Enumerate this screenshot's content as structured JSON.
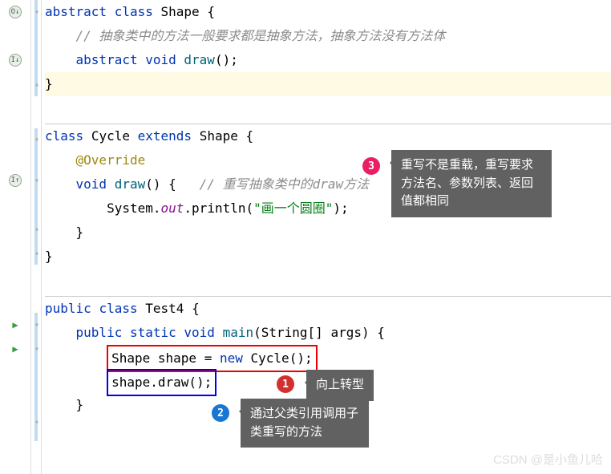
{
  "code": {
    "shape_decl": {
      "kw1": "abstract",
      "kw2": "class",
      "name": "Shape",
      "brace": "{"
    },
    "shape_comment": "// 抽象类中的方法一般要求都是抽象方法，抽象方法没有方法体",
    "shape_method": {
      "kw1": "abstract",
      "kw2": "void",
      "name": "draw",
      "parens": "();"
    },
    "close_brace": "}",
    "cycle_decl": {
      "kw1": "class",
      "name": "Cycle",
      "kw2": "extends",
      "parent": "Shape",
      "brace": "{"
    },
    "override": "@Override",
    "cycle_method": {
      "kw1": "void",
      "name": "draw",
      "parens": "() {",
      "comment": "// 重写抽象类中的draw方法"
    },
    "println": {
      "cls": "System",
      "field": "out",
      "method": "println",
      "open": "(",
      "str": "\"画一个圆圈\"",
      "close": ");"
    },
    "test_decl": {
      "kw1": "public",
      "kw2": "class",
      "name": "Test4",
      "brace": "{"
    },
    "main_decl": {
      "kw1": "public",
      "kw2": "static",
      "kw3": "void",
      "name": "main",
      "args": "(String[] args) {"
    },
    "stmt1": {
      "type": "Shape",
      "var": "shape",
      "eq": "=",
      "kw": "new",
      "ctor": "Cycle",
      "end": "();"
    },
    "stmt2": {
      "var": "shape",
      "dot": ".",
      "method": "draw",
      "end": "();"
    }
  },
  "callouts": {
    "c1": "向上转型",
    "c2": "通过父类引用调用子类重写的方法",
    "c3": "重写不是重载，重写要求方法名、参数列表、返回值都相同"
  },
  "badges": {
    "b1": "1",
    "b2": "2",
    "b3": "3"
  },
  "gutter": {
    "override_up": "O↓",
    "override_down": "I↓",
    "impl_up": "I↑",
    "run": "▶"
  },
  "watermark": "CSDN @是小鱼儿哈"
}
